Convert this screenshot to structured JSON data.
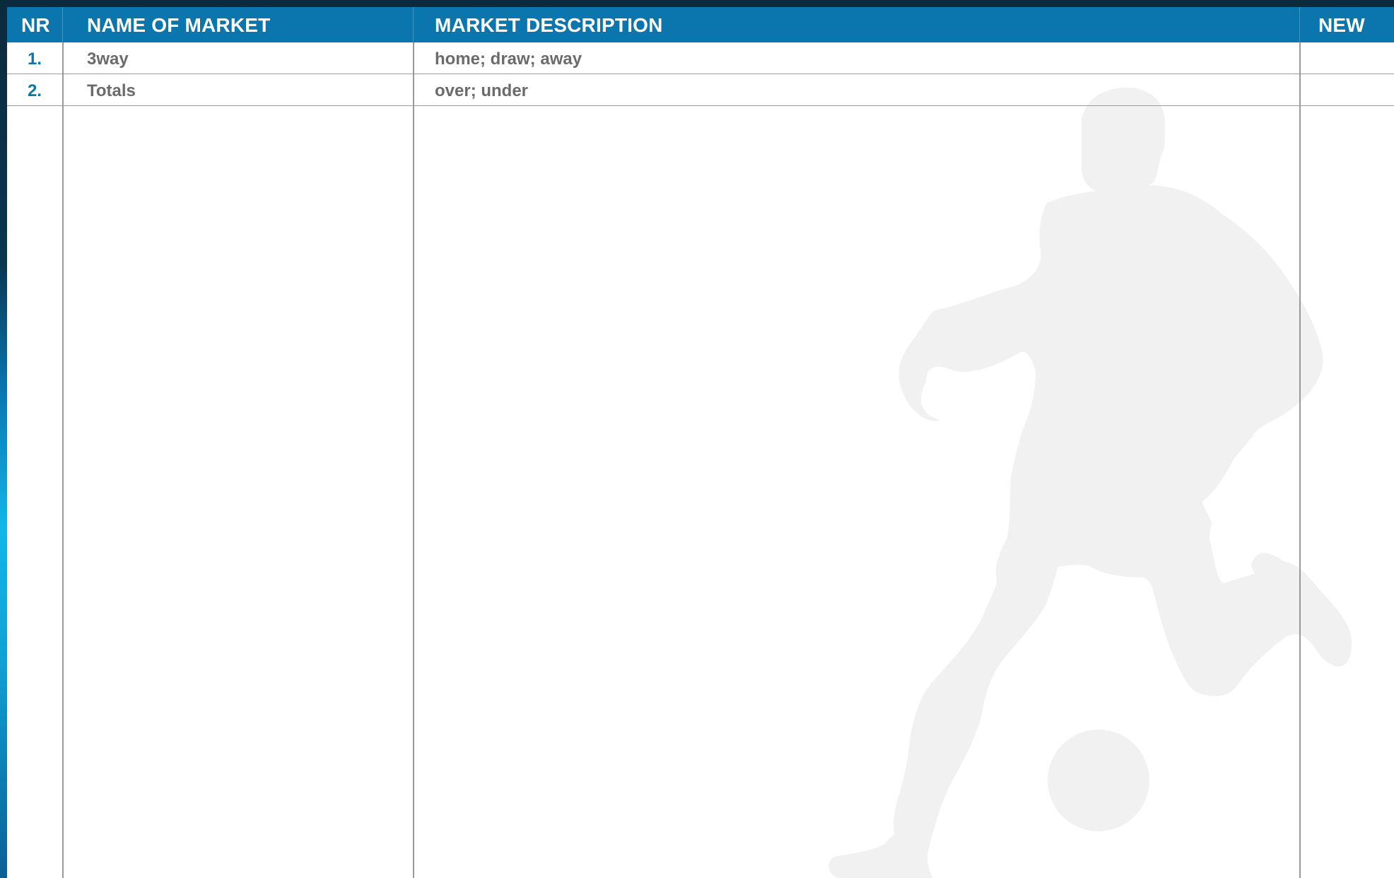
{
  "colors": {
    "header_bg": "#0a76ad",
    "number_text": "#0a76ad",
    "body_text": "#6b6b6b",
    "silhouette": "#f1f1f1"
  },
  "table": {
    "headers": {
      "nr": "NR",
      "name": "NAME OF MARKET",
      "description": "MARKET DESCRIPTION",
      "new": "NEW"
    },
    "rows": [
      {
        "nr": "1.",
        "name": "3way",
        "description": "home; draw; away",
        "new": ""
      },
      {
        "nr": "2.",
        "name": "Totals",
        "description": "over; under",
        "new": ""
      }
    ]
  },
  "background_graphic": "soccer-player-silhouette"
}
